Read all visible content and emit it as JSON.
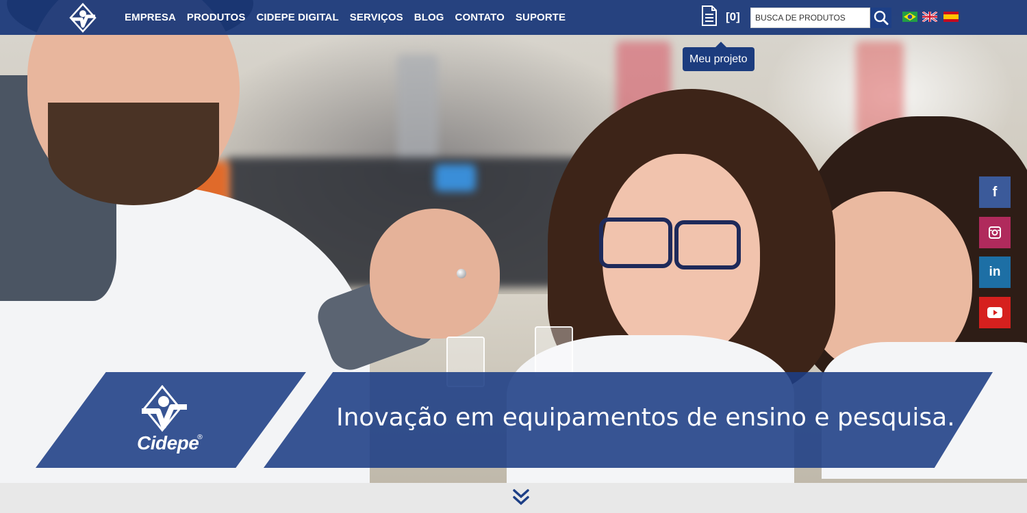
{
  "nav": {
    "items": [
      "EMPRESA",
      "PRODUTOS",
      "CIDEPE DIGITAL",
      "SERVIÇOS",
      "BLOG",
      "CONTATO",
      "SUPORTE"
    ]
  },
  "project": {
    "count_label": "[0]",
    "tooltip": "Meu projeto",
    "icon": "document-icon"
  },
  "search": {
    "placeholder": "BUSCA DE PRODUTOS",
    "value": "",
    "icon": "search-icon"
  },
  "languages": [
    "brazil-flag-icon",
    "uk-flag-icon",
    "spain-flag-icon"
  ],
  "social": {
    "facebook": "f",
    "instagram": "instagram-icon",
    "linkedin": "in",
    "youtube": "youtube-icon"
  },
  "banner": {
    "brand": "Cidepe",
    "registered": "®",
    "tagline": "Inovação em equipamentos de ensino e pesquisa."
  },
  "colors": {
    "nav_bg": "#183778",
    "banner_bg": "#1c3e85",
    "facebook": "#3b5a9a",
    "instagram": "#b02a5c",
    "linkedin": "#1d6fa5",
    "youtube": "#d6201e"
  },
  "scroll": {
    "icon": "double-chevron-down-icon"
  }
}
